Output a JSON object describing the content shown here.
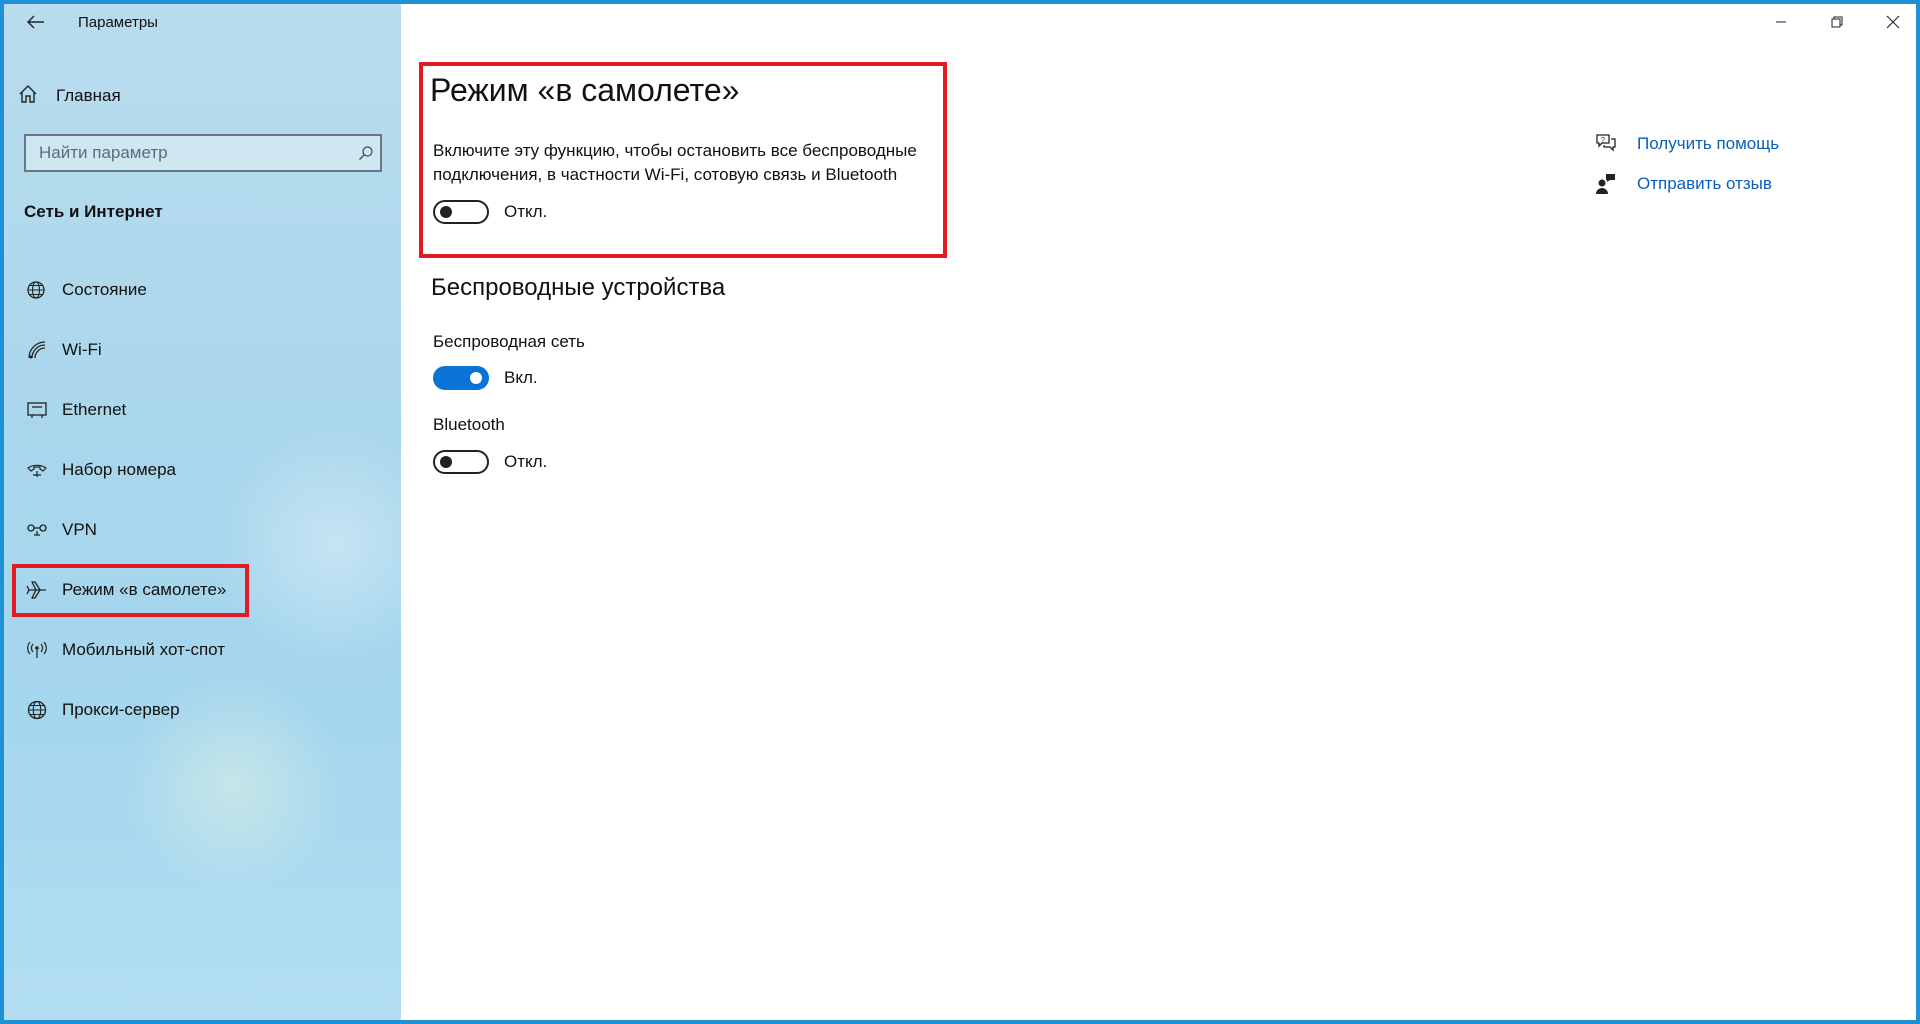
{
  "window": {
    "title": "Параметры",
    "accent_color": "#0a74d6",
    "highlight_color": "#e31b23",
    "controls": [
      "minimize-icon",
      "restore-icon",
      "close-icon"
    ]
  },
  "sidebar": {
    "back_icon": "back-arrow-icon",
    "home": {
      "label": "Главная",
      "icon": "home-icon"
    },
    "search": {
      "placeholder": "Найти параметр",
      "value": "",
      "icon": "search-icon"
    },
    "section_title": "Сеть и Интернет",
    "items": [
      {
        "label": "Состояние",
        "icon": "globe-status-icon",
        "selected": false
      },
      {
        "label": "Wi-Fi",
        "icon": "wifi-icon",
        "selected": false
      },
      {
        "label": "Ethernet",
        "icon": "ethernet-icon",
        "selected": false
      },
      {
        "label": "Набор номера",
        "icon": "dial-up-icon",
        "selected": false
      },
      {
        "label": "VPN",
        "icon": "vpn-icon",
        "selected": false
      },
      {
        "label": "Режим «в самолете»",
        "icon": "airplane-icon",
        "selected": true
      },
      {
        "label": "Мобильный хот-спот",
        "icon": "hotspot-icon",
        "selected": false
      },
      {
        "label": "Прокси-сервер",
        "icon": "globe-icon",
        "selected": false
      }
    ]
  },
  "main": {
    "title": "Режим «в самолете»",
    "description": "Включите эту функцию, чтобы остановить все беспроводные подключения, в частности Wi-Fi, сотовую связь и Bluetooth",
    "airplane_toggle": {
      "state": false,
      "label": "Откл."
    },
    "wireless_heading": "Беспроводные устройства",
    "devices": [
      {
        "name": "Беспроводная сеть",
        "state": true,
        "label": "Вкл."
      },
      {
        "name": "Bluetooth",
        "state": false,
        "label": "Откл."
      }
    ],
    "related": [
      {
        "label": "Получить помощь",
        "icon": "help-chat-icon"
      },
      {
        "label": "Отправить отзыв",
        "icon": "feedback-icon"
      }
    ]
  }
}
